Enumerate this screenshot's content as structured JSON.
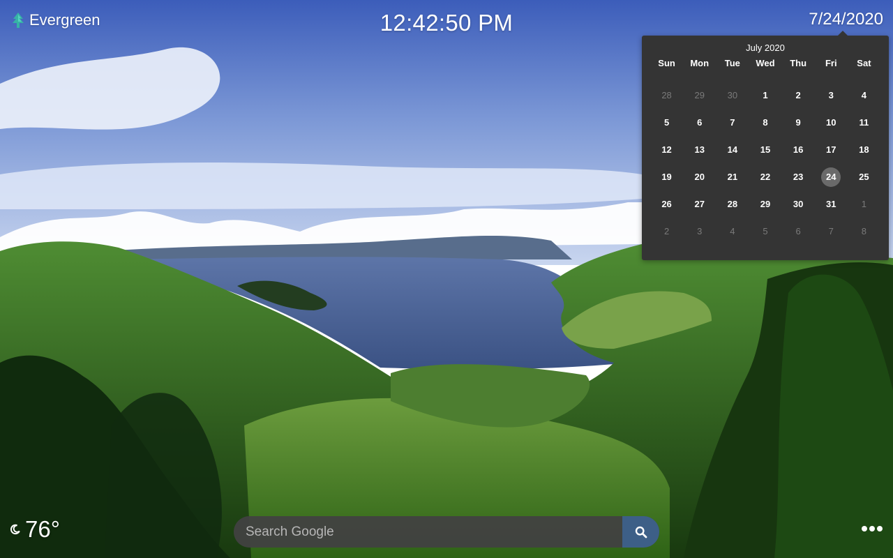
{
  "brand": {
    "name": "Evergreen",
    "icon": "evergreen-tree-icon"
  },
  "clock": {
    "time": "12:42:50 PM"
  },
  "date": {
    "display": "7/24/2020"
  },
  "calendar": {
    "title": "July 2020",
    "weekdays": [
      "Sun",
      "Mon",
      "Tue",
      "Wed",
      "Thu",
      "Fri",
      "Sat"
    ],
    "weeks": [
      [
        "28",
        "29",
        "30",
        "1",
        "2",
        "3",
        "4"
      ],
      [
        "5",
        "6",
        "7",
        "8",
        "9",
        "10",
        "11"
      ],
      [
        "12",
        "13",
        "14",
        "15",
        "16",
        "17",
        "18"
      ],
      [
        "19",
        "20",
        "21",
        "22",
        "23",
        "24",
        "25"
      ],
      [
        "26",
        "27",
        "28",
        "29",
        "30",
        "31",
        "1"
      ],
      [
        "2",
        "3",
        "4",
        "5",
        "6",
        "7",
        "8"
      ]
    ],
    "selected": "24"
  },
  "weather": {
    "temperature": "76°",
    "icon": "moon-icon"
  },
  "search": {
    "placeholder": "Search Google",
    "button_icon": "search-icon"
  },
  "menu": {
    "icon": "more-dots-icon"
  }
}
